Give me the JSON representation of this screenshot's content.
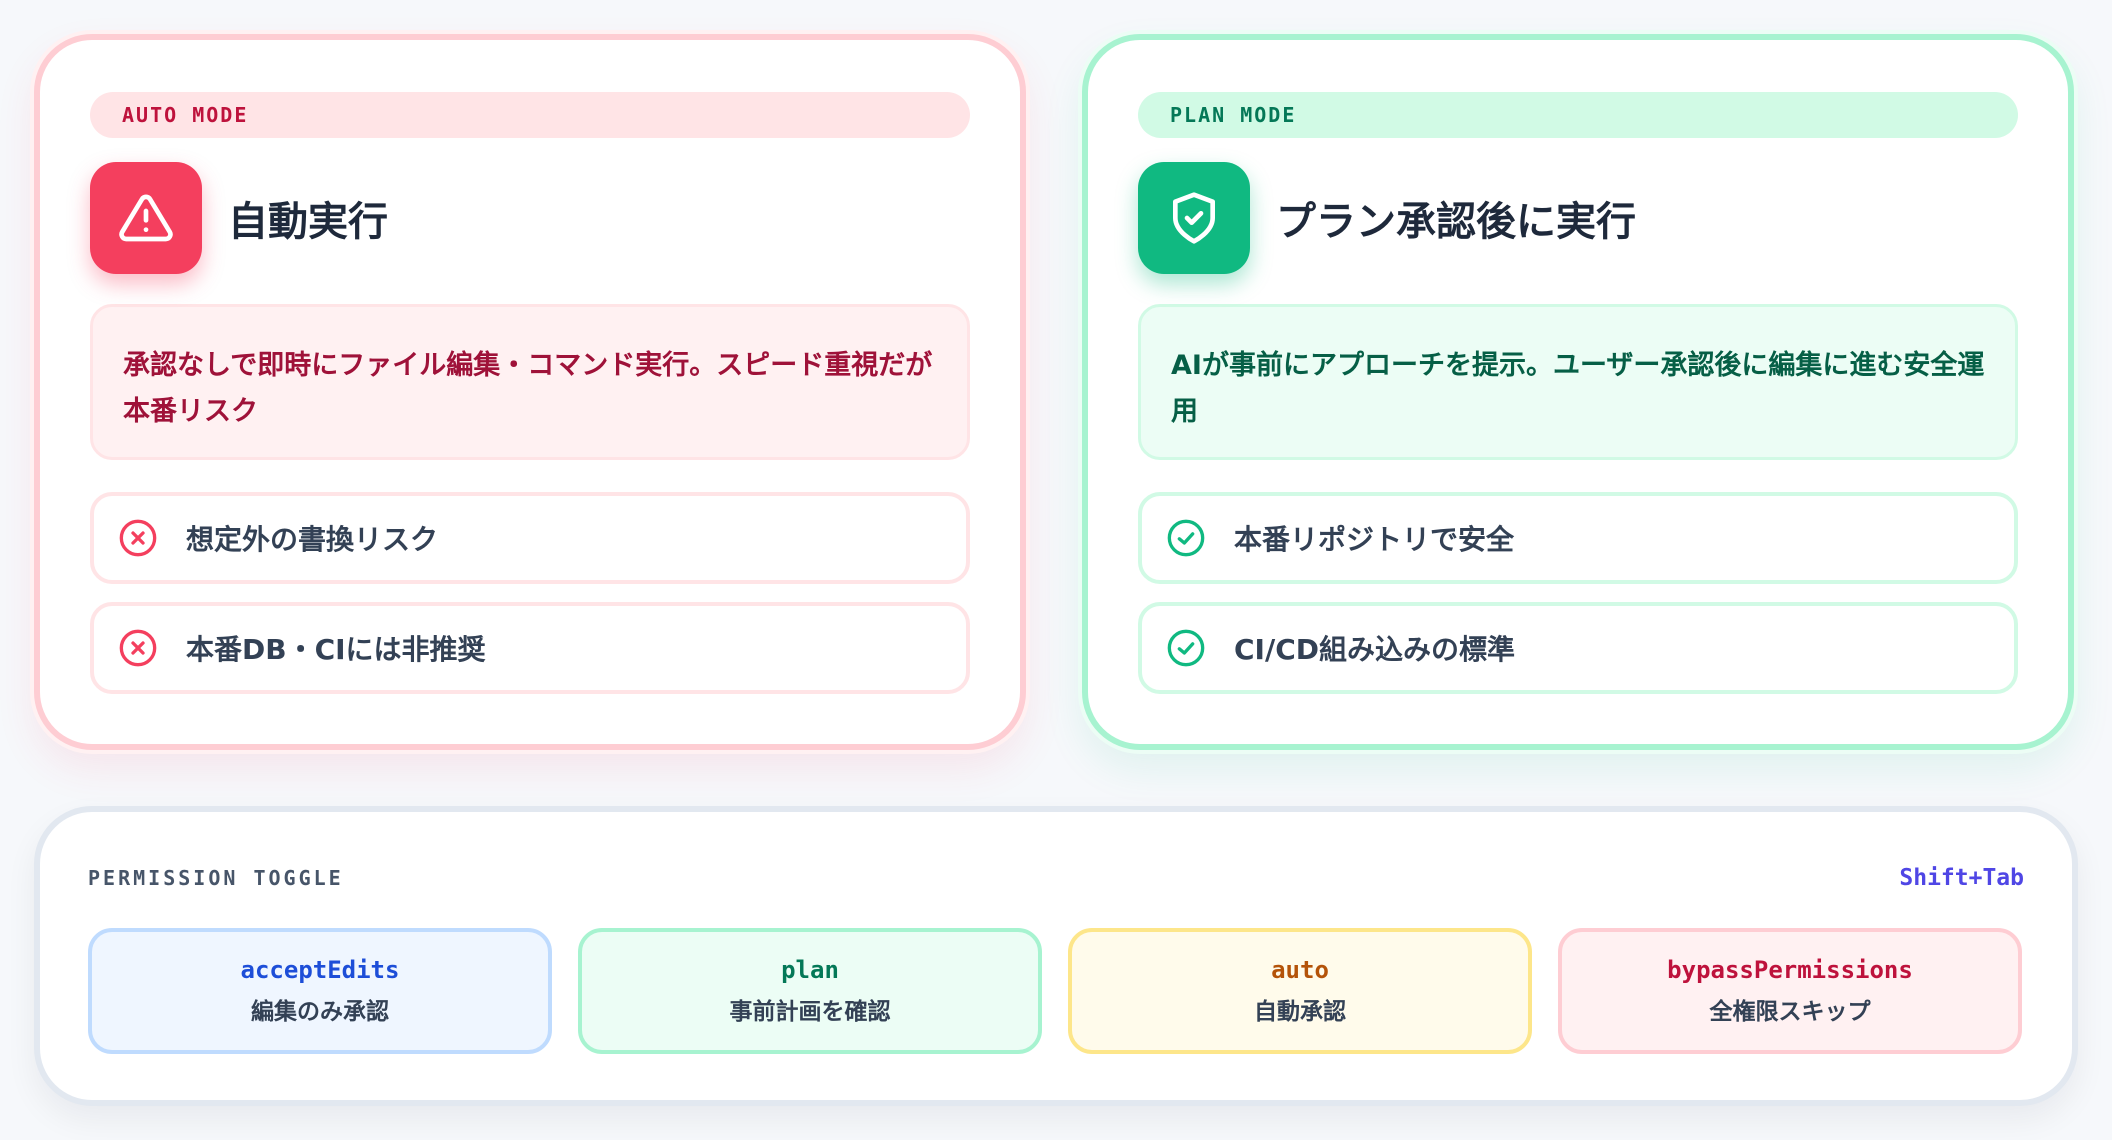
{
  "auto_card": {
    "tag": "AUTO MODE",
    "title": "自動実行",
    "icon": "warning-triangle-icon",
    "description": "承認なしで即時にファイル編集・コマンド実行。スピード重視だが本番リスク",
    "points": [
      {
        "icon": "x-circle-icon",
        "label": "想定外の書換リスク"
      },
      {
        "icon": "x-circle-icon",
        "label": "本番DB・CIには非推奨"
      }
    ],
    "accent": "#f43f5e"
  },
  "plan_card": {
    "tag": "PLAN MODE",
    "title": "プラン承認後に実行",
    "icon": "shield-check-icon",
    "description": "AIが事前にアプローチを提示。ユーザー承認後に編集に進む安全運用",
    "points": [
      {
        "icon": "check-circle-icon",
        "label": "本番リポジトリで安全"
      },
      {
        "icon": "check-circle-icon",
        "label": "CI/CD組み込みの標準"
      }
    ],
    "accent": "#10b981"
  },
  "permission_toggle": {
    "label": "PERMISSION TOGGLE",
    "shortcut": "Shift+Tab",
    "options": [
      {
        "name": "acceptEdits",
        "desc": "編集のみ承認"
      },
      {
        "name": "plan",
        "desc": "事前計画を確認"
      },
      {
        "name": "auto",
        "desc": "自動承認"
      },
      {
        "name": "bypassPermissions",
        "desc": "全権限スキップ"
      }
    ]
  }
}
